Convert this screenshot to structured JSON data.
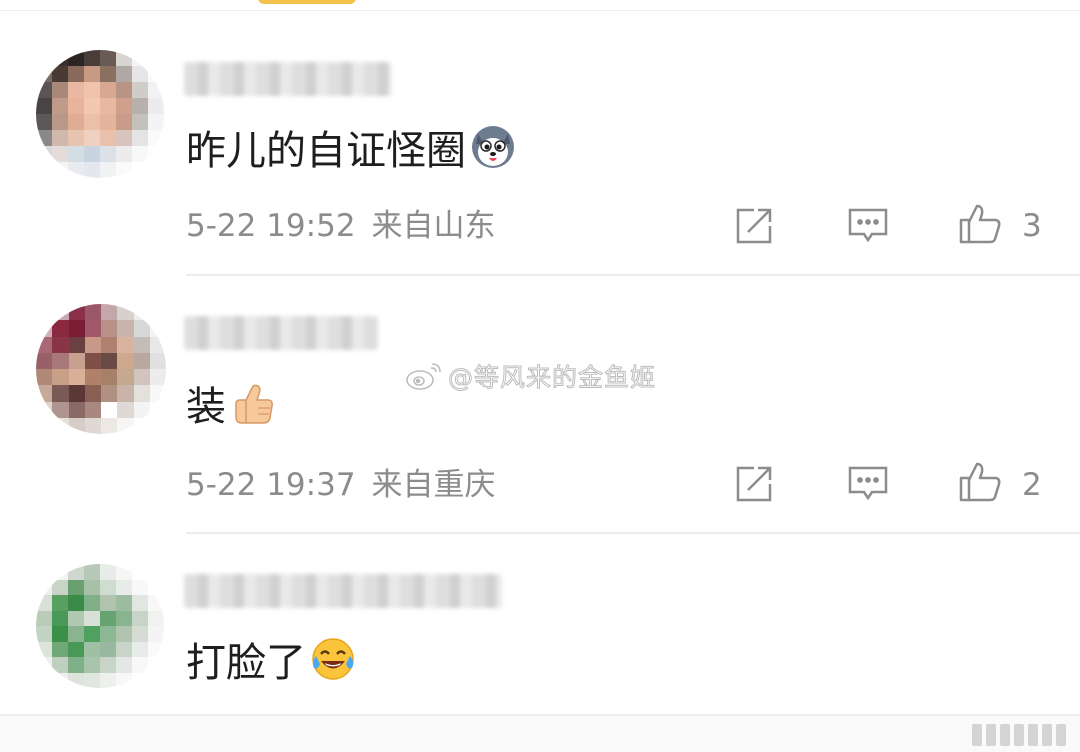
{
  "comments": [
    {
      "text": "昨儿的自证怪圈",
      "emoji": "husky-dog-emoji",
      "time": "5-22 19:52",
      "location": "来自山东",
      "likes": "3"
    },
    {
      "text": "装",
      "emoji": "thumbs-up-emoji",
      "time": "5-22 19:37",
      "location": "来自重庆",
      "likes": "2"
    },
    {
      "text": "打脸了",
      "emoji": "laughing-tears-emoji",
      "time": "",
      "location": "",
      "likes": ""
    }
  ],
  "watermark": {
    "text": "@等风来的金鱼姬",
    "icon": "weibo-icon"
  },
  "icons": {
    "share": "share-icon",
    "reply": "comment-icon",
    "like": "thumbs-up-icon"
  },
  "colors": {
    "meta_text": "#8c8c8c",
    "content_text": "#1e1e1e",
    "divider": "#ececec",
    "accent_pill": "#f5c14a"
  }
}
